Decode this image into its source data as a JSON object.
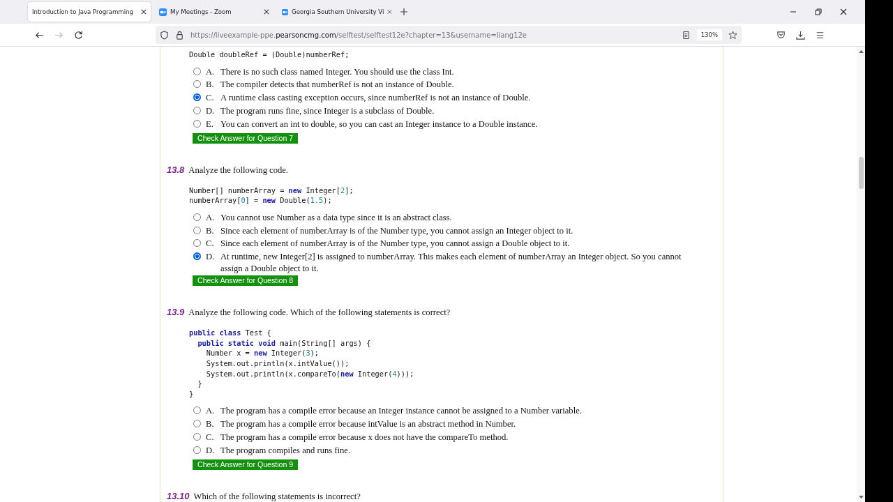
{
  "browser": {
    "tabs": [
      {
        "title": "Introduction to Java Programming",
        "selected": true
      },
      {
        "title": "My Meetings - Zoom",
        "selected": false
      },
      {
        "title": "Georgia Southern University Vi",
        "selected": false
      }
    ],
    "url": {
      "prefix": "https://liveexample-ppe.",
      "domain": "pearsoncmg.com",
      "path": "/selftest/selftest12e?chapter=13&username=liang12e"
    },
    "zoom": "130%"
  },
  "questions": [
    {
      "code": [
        [
          {
            "t": "Double doubleRef = (Double)numberRef;",
            "kind": "plain"
          }
        ]
      ],
      "options": [
        {
          "letter": "A.",
          "text": "There is no such class named Integer. You should use the class Int.",
          "selected": false
        },
        {
          "letter": "B.",
          "text": "The compiler detects that numberRef is not an instance of Double.",
          "selected": false
        },
        {
          "letter": "C.",
          "text": "A runtime class casting exception occurs, since numberRef is not an instance of Double.",
          "selected": true
        },
        {
          "letter": "D.",
          "text": "The program runs fine, since Integer is a subclass of Double.",
          "selected": false
        },
        {
          "letter": "E.",
          "text": "You can convert an int to double, so you can cast an Integer instance to a Double instance.",
          "selected": false
        }
      ],
      "button": "Check Answer for Question 7"
    },
    {
      "number": "13.8",
      "prompt": "Analyze the following code.",
      "code": [
        [
          {
            "t": "Number[] numberArray = ",
            "kind": "plain"
          },
          {
            "t": "new",
            "kind": "kw"
          },
          {
            "t": " Integer[",
            "kind": "plain"
          },
          {
            "t": "2",
            "kind": "num"
          },
          {
            "t": "];",
            "kind": "plain"
          }
        ],
        [
          {
            "t": "numberArray[",
            "kind": "plain"
          },
          {
            "t": "0",
            "kind": "num"
          },
          {
            "t": "] = ",
            "kind": "plain"
          },
          {
            "t": "new",
            "kind": "kw"
          },
          {
            "t": " Double(",
            "kind": "plain"
          },
          {
            "t": "1.5",
            "kind": "num"
          },
          {
            "t": ");",
            "kind": "plain"
          }
        ]
      ],
      "options": [
        {
          "letter": "A.",
          "text": "You cannot use Number as a data type since it is an abstract class.",
          "selected": false
        },
        {
          "letter": "B.",
          "text": "Since each element of numberArray is of the Number type, you cannot assign an Integer object to it.",
          "selected": false
        },
        {
          "letter": "C.",
          "text": "Since each element of numberArray is of the Number type, you cannot assign a Double object to it.",
          "selected": false
        },
        {
          "letter": "D.",
          "text": "At runtime, new Integer[2] is assigned to numberArray. This makes each element of numberArray an Integer object. So you cannot assign a Double object to it.",
          "selected": true
        }
      ],
      "button": "Check Answer for Question 8"
    },
    {
      "number": "13.9",
      "prompt": "Analyze the following code. Which of the following statements is correct?",
      "code": [
        [
          {
            "t": "public class",
            "kind": "kw"
          },
          {
            "t": " Test {",
            "kind": "plain"
          }
        ],
        [
          {
            "t": "  public static void",
            "kind": "kw"
          },
          {
            "t": " main(String[] args) {",
            "kind": "plain"
          }
        ],
        [
          {
            "t": "    Number x = ",
            "kind": "plain"
          },
          {
            "t": "new",
            "kind": "kw"
          },
          {
            "t": " Integer(",
            "kind": "plain"
          },
          {
            "t": "3",
            "kind": "num"
          },
          {
            "t": ");",
            "kind": "plain"
          }
        ],
        [
          {
            "t": "    System.out.println(x.intValue());",
            "kind": "plain"
          }
        ],
        [
          {
            "t": "    System.out.println(x.compareTo(",
            "kind": "plain"
          },
          {
            "t": "new",
            "kind": "kw"
          },
          {
            "t": " Integer(",
            "kind": "plain"
          },
          {
            "t": "4",
            "kind": "num"
          },
          {
            "t": ")));",
            "kind": "plain"
          }
        ],
        [
          {
            "t": "  }",
            "kind": "plain"
          }
        ],
        [
          {
            "t": "}",
            "kind": "plain"
          }
        ]
      ],
      "options": [
        {
          "letter": "A.",
          "text": "The program has a compile error because an Integer instance cannot be assigned to a Number variable.",
          "selected": false
        },
        {
          "letter": "B.",
          "text": "The program has a compile error because intValue is an abstract method in Number.",
          "selected": false
        },
        {
          "letter": "C.",
          "text": "The program has a compile error because x does not have the compareTo method.",
          "selected": false
        },
        {
          "letter": "D.",
          "text": "The program compiles and runs fine.",
          "selected": false
        }
      ],
      "button": "Check Answer for Question 9"
    },
    {
      "number": "13.10",
      "prompt": "Which of the following statements is incorrect?"
    }
  ]
}
